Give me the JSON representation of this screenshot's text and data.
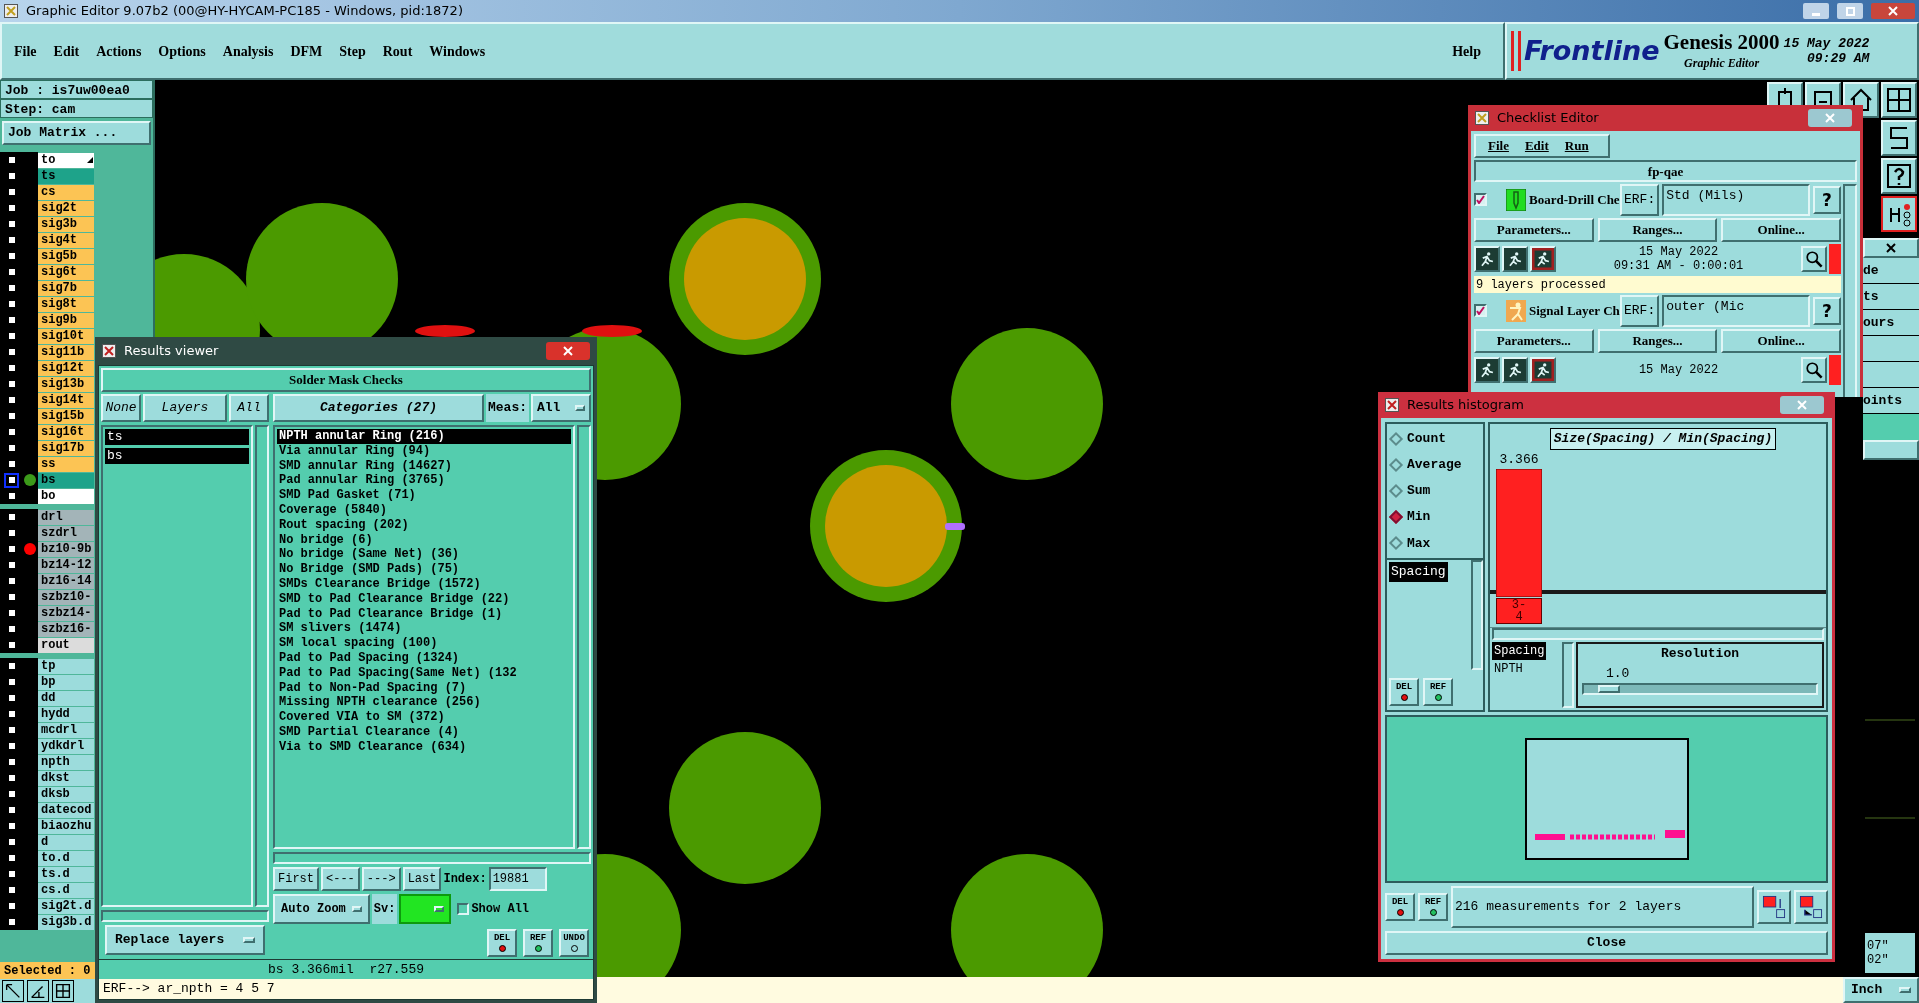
{
  "window": {
    "title": "Graphic Editor 9.07b2 (00@HY-HYCAM-PC185 - Windows, pid:1872)"
  },
  "menu": [
    "File",
    "Edit",
    "Actions",
    "Options",
    "Analysis",
    "DFM",
    "Step",
    "Rout",
    "Windows"
  ],
  "help": "Help",
  "brand": {
    "logo": "Frontline",
    "product": "Genesis 2000",
    "subtitle": "Graphic Editor",
    "date": "15 May 2022",
    "time": "09:29 AM"
  },
  "job_panel": {
    "job": "Job : is7uw00ea0",
    "step": "Step: cam",
    "matrix_button": "Job Matrix ...",
    "selected": "Selected : 0"
  },
  "layer_groups": [
    [
      {
        "name": "to",
        "color": "#ffffff",
        "current": false,
        "pointer": true
      },
      {
        "name": "ts",
        "color": "#1ea38a",
        "current": false
      },
      {
        "name": "cs",
        "color": "#fcc454",
        "current": false
      },
      {
        "name": "sig2t",
        "color": "#fcc454",
        "current": false
      },
      {
        "name": "sig3b",
        "color": "#fcc454",
        "current": false
      },
      {
        "name": "sig4t",
        "color": "#fcc454",
        "current": false
      },
      {
        "name": "sig5b",
        "color": "#fcc454",
        "current": false
      },
      {
        "name": "sig6t",
        "color": "#fcc454",
        "current": false
      },
      {
        "name": "sig7b",
        "color": "#fcc454",
        "current": false
      },
      {
        "name": "sig8t",
        "color": "#fcc454",
        "current": false
      },
      {
        "name": "sig9b",
        "color": "#fcc454",
        "current": false
      },
      {
        "name": "sig10t",
        "color": "#fcc454",
        "current": false
      },
      {
        "name": "sig11b",
        "color": "#fcc454",
        "current": false
      },
      {
        "name": "sig12t",
        "color": "#fcc454",
        "current": false
      },
      {
        "name": "sig13b",
        "color": "#fcc454",
        "current": false
      },
      {
        "name": "sig14t",
        "color": "#fcc454",
        "current": false
      },
      {
        "name": "sig15b",
        "color": "#fcc454",
        "current": false
      },
      {
        "name": "sig16t",
        "color": "#fcc454",
        "current": false
      },
      {
        "name": "sig17b",
        "color": "#fcc454",
        "current": false
      },
      {
        "name": "ss",
        "color": "#fcc454",
        "current": false
      },
      {
        "name": "bs",
        "color": "#1ea38a",
        "current": true,
        "dot": {
          "color": "#3c9a1a"
        }
      },
      {
        "name": "bo",
        "color": "#ffffff",
        "current": false
      }
    ],
    [
      {
        "name": "drl",
        "color": "#a3b4b8",
        "current": false
      },
      {
        "name": "szdrl",
        "color": "#a3b4b8",
        "current": false
      },
      {
        "name": "bz10-9b",
        "color": "#a3b4b8",
        "current": false,
        "dot": {
          "color": "#ff0000"
        }
      },
      {
        "name": "bz14-12",
        "color": "#a3b4b8",
        "current": false
      },
      {
        "name": "bz16-14",
        "color": "#a3b4b8",
        "current": false
      },
      {
        "name": "szbz10-",
        "color": "#a3b4b8",
        "current": false
      },
      {
        "name": "szbz14-",
        "color": "#a3b4b8",
        "current": false
      },
      {
        "name": "szbz16-",
        "color": "#a3b4b8",
        "current": false
      },
      {
        "name": "rout",
        "color": "#dcdcdc",
        "current": false
      }
    ],
    [
      {
        "name": "tp",
        "color": "#9cdcdc",
        "current": false
      },
      {
        "name": "bp",
        "color": "#9cdcdc",
        "current": false
      },
      {
        "name": "dd",
        "color": "#9cdcdc",
        "current": false
      },
      {
        "name": "hydd",
        "color": "#9cdcdc",
        "current": false
      },
      {
        "name": "mcdrl",
        "color": "#9cdcdc",
        "current": false
      },
      {
        "name": "ydkdrl",
        "color": "#9cdcdc",
        "current": false
      },
      {
        "name": "npth",
        "color": "#9cdcdc",
        "current": false
      },
      {
        "name": "dkst",
        "color": "#9cdcdc",
        "current": false
      },
      {
        "name": "dksb",
        "color": "#9cdcdc",
        "current": false
      },
      {
        "name": "datecod",
        "color": "#9cdcdc",
        "current": false
      },
      {
        "name": "biaozhu",
        "color": "#9cdcdc",
        "current": false
      },
      {
        "name": "d",
        "color": "#9cdcdc",
        "current": false
      },
      {
        "name": "to.d",
        "color": "#9cdcdc",
        "current": false
      },
      {
        "name": "ts.d",
        "color": "#9cdcdc",
        "current": false
      },
      {
        "name": "cs.d",
        "color": "#9cdcdc",
        "current": false
      },
      {
        "name": "sig2t.d",
        "color": "#9cdcdc",
        "current": false
      },
      {
        "name": "sig3b.d",
        "color": "#9cdcdc",
        "current": false
      }
    ]
  ],
  "results_viewer": {
    "title": "Results viewer",
    "heading": "Solder Mask Checks",
    "layer_buttons": [
      "None",
      "Layers",
      "All"
    ],
    "layers": [
      {
        "name": "ts",
        "selected": true
      },
      {
        "name": "bs",
        "selected": true
      }
    ],
    "categories_header": "Categories (27)",
    "meas_label": "Meas:",
    "meas_value": "All",
    "categories": [
      {
        "label": "NPTH annular Ring (216)",
        "selected": true
      },
      {
        "label": "Via annular Ring (94)",
        "selected": false
      },
      {
        "label": "SMD annular Ring (14627)",
        "selected": false
      },
      {
        "label": "Pad annular Ring (3765)",
        "selected": false
      },
      {
        "label": "SMD Pad Gasket (71)",
        "selected": false
      },
      {
        "label": "Coverage (5840)",
        "selected": false
      },
      {
        "label": "Rout spacing (202)",
        "selected": false
      },
      {
        "label": "No bridge (6)",
        "selected": false
      },
      {
        "label": "No bridge (Same Net) (36)",
        "selected": false
      },
      {
        "label": "No Bridge (SMD Pads) (75)",
        "selected": false
      },
      {
        "label": "SMDs Clearance Bridge (1572)",
        "selected": false
      },
      {
        "label": "SMD to Pad Clearance Bridge (22)",
        "selected": false
      },
      {
        "label": "Pad to Pad Clearance Bridge (1)",
        "selected": false
      },
      {
        "label": "SM slivers (1474)",
        "selected": false
      },
      {
        "label": "SM local spacing (100)",
        "selected": false
      },
      {
        "label": "Pad to Pad Spacing (1324)",
        "selected": false
      },
      {
        "label": "Pad to Pad Spacing(Same Net) (132",
        "selected": false
      },
      {
        "label": "Pad to Non-Pad Spacing (7)",
        "selected": false
      },
      {
        "label": "Missing NPTH clearance (256)",
        "selected": false
      },
      {
        "label": "Covered VIA to SM (372)",
        "selected": false
      },
      {
        "label": "SMD Partial Clearance (4)",
        "selected": false
      },
      {
        "label": "Via to SMD Clearance (634)",
        "selected": false
      }
    ],
    "nav_buttons": [
      "First",
      "<---",
      "--->",
      "Last"
    ],
    "index_label": "Index:",
    "index_value": "19881",
    "zoom_mode": "Auto Zoom",
    "sv_label": "Sv:",
    "show_all": {
      "label": "Show All",
      "checked": false
    },
    "layer_mode": "Replace layers",
    "tools": [
      "DEL",
      "REF",
      "UNDO"
    ],
    "status": "bs 3.366mil  r27.559",
    "erf_line": "ERF--> ar_npth = 4 5 7"
  },
  "checklist_editor": {
    "title": "Checklist Editor",
    "menu": [
      "File",
      "Edit",
      "Run"
    ],
    "name": "fp-qae",
    "checks": [
      {
        "kind": "drill",
        "name": "Board-Drill Che",
        "checked": true,
        "erf_label": "ERF:",
        "erf": "Std (Mils)",
        "help": "?",
        "buttons": [
          "Parameters...",
          "Ranges...",
          "Online..."
        ],
        "date": "15 May 2022",
        "time": "09:31 AM - 0:00:01",
        "status": "9 layers processed"
      },
      {
        "kind": "signal",
        "name": "Signal Layer Ch",
        "checked": true,
        "erf_label": "ERF:",
        "erf": "outer (Mic",
        "help": "?",
        "buttons": [
          "Parameters...",
          "Ranges...",
          "Online..."
        ],
        "date": "15 May 2022"
      }
    ]
  },
  "side_panel": {
    "labels": [
      "de",
      "ts",
      "ours",
      "oints"
    ],
    "coords": [
      "07\"",
      "02\""
    ],
    "units": "Inch"
  },
  "histogram": {
    "title": "Results histogram",
    "modes": [
      {
        "label": "Count",
        "selected": false
      },
      {
        "label": "Average",
        "selected": false
      },
      {
        "label": "Sum",
        "selected": false
      },
      {
        "label": "Min",
        "selected": true
      },
      {
        "label": "Max",
        "selected": false
      }
    ],
    "fields": [
      {
        "label": "Spacing",
        "selected": true
      }
    ],
    "list_tools": [
      "DEL",
      "REF"
    ],
    "plot": {
      "title": "Size(Spacing) / Min(Spacing)",
      "bins": [
        {
          "value_label": "3.366",
          "range_label": "3-4"
        }
      ]
    },
    "columns": [
      {
        "label": "Spacing",
        "selected": true
      },
      {
        "label": "NPTH",
        "selected": false
      }
    ],
    "resolution_label": "Resolution",
    "resolution_value": "1.0",
    "resolution": {
      "level": 0.06
    },
    "footer_tools": [
      "DEL",
      "REF"
    ],
    "summary": "216 measurements for 2 layers",
    "close": "Close"
  }
}
